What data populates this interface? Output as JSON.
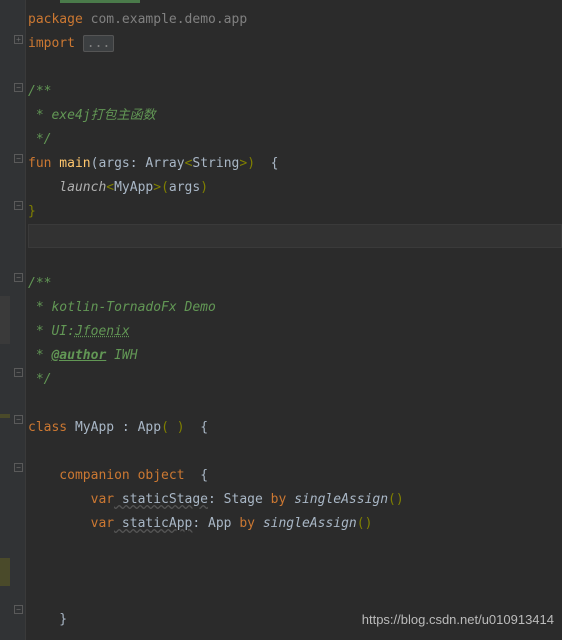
{
  "watermark": "https://blog.csdn.net/u010913414",
  "code": {
    "l1_package": "package",
    "l1_pkg": " com.example.demo.app",
    "l2_import": "import",
    "l2_dots": "...",
    "l4_a": "/**",
    "l5_a": " * exe4j打包主函数",
    "l6_a": " */",
    "l7_fun": "fun",
    "l7_main": " main",
    "l7_open": "(",
    "l7_args": "args: ",
    "l7_array": "Array",
    "l7_lt": "<",
    "l7_string": "String",
    "l7_gt": ">",
    "l7_close": ")",
    "l7_brace": "  {",
    "l8_launch": "    launch",
    "l8_lt": "<",
    "l8_myapp": "MyApp",
    "l8_gt": ">",
    "l8_open": "(",
    "l8_args": "args",
    "l8_close": ")",
    "l9_brace": "}",
    "l12_a": "/**",
    "l13_a": " * kotlin-TornadoFx Demo",
    "l14_a": " * UI:",
    "l14_b": "Jfoenix",
    "l15_a": " * ",
    "l15_b": "@author",
    "l15_c": " IWH",
    "l16_a": " */",
    "l18_class": "class",
    "l18_name": " MyApp : App",
    "l18_open": "( )",
    "l18_brace": "  {",
    "l20_comp": "    companion",
    "l20_obj": " object",
    "l20_brace": "  {",
    "l21_var": "        var",
    "l21_name": " staticStage",
    "l21_type": ": Stage ",
    "l21_by": "by",
    "l21_fn": " singleAssign",
    "l21_p": "()",
    "l22_var": "        var",
    "l22_name": " staticApp",
    "l22_type": ": App ",
    "l22_by": "by",
    "l22_fn": " singleAssign",
    "l22_p": "()",
    "l26_brace": "    }"
  }
}
